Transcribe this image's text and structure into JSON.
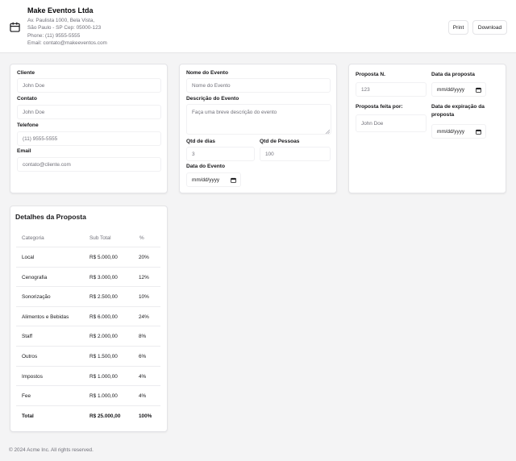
{
  "company": {
    "name": "Make Eventos Ltda",
    "address_line1": "Av. Paulista 1000, Bela Vista,",
    "address_line2": "São Paulo - SP Cep: 05000-123",
    "phone": "Phone: (11) 9555-5555",
    "email": "Email: contato@makeeventos.com"
  },
  "toolbar": {
    "print_label": "Print",
    "download_label": "Download"
  },
  "client": {
    "cliente_label": "Cliente",
    "cliente_placeholder": "John Doe",
    "contato_label": "Contato",
    "contato_placeholder": "John Doe",
    "telefone_label": "Telefone",
    "telefone_placeholder": "(11) 9555-5555",
    "email_label": "Email",
    "email_placeholder": "contato@cliente.com"
  },
  "event": {
    "nome_label": "Nome do Evento",
    "nome_placeholder": "Nome do Evento",
    "descricao_label": "Descrição do Evento",
    "descricao_placeholder": "Faça uma breve descrição do evento",
    "qtd_dias_label": "Qtd de dias",
    "qtd_dias_placeholder": "3",
    "qtd_pessoas_label": "Qtd de Pessoas",
    "qtd_pessoas_placeholder": "100",
    "data_label": "Data do Evento",
    "data_value": "mm/dd/yyyy"
  },
  "proposal": {
    "numero_label": "Proposta N.",
    "numero_placeholder": "123",
    "data_label": "Data da proposta",
    "data_value": "mm/dd/yyyy",
    "feita_por_label": "Proposta feita por:",
    "feita_por_placeholder": "John Doe",
    "expiracao_label": "Data de expiração da proposta",
    "expiracao_value": "mm/dd/yyyy"
  },
  "details": {
    "title": "Detalhes da Proposta",
    "columns": [
      "Categoria",
      "Sub Total",
      "%"
    ],
    "rows": [
      [
        "Local",
        "R$ 5.000,00",
        "20%"
      ],
      [
        "Cenografia",
        "R$ 3.000,00",
        "12%"
      ],
      [
        "Sonorização",
        "R$ 2.500,00",
        "10%"
      ],
      [
        "Alimentos e Bebidas",
        "R$ 6.000,00",
        "24%"
      ],
      [
        "Staff",
        "R$ 2.000,00",
        "8%"
      ],
      [
        "Outros",
        "R$ 1.500,00",
        "6%"
      ],
      [
        "Impostos",
        "R$ 1.000,00",
        "4%"
      ],
      [
        "Fee",
        "R$ 1.000,00",
        "4%"
      ],
      [
        "Total",
        "R$ 25.000,00",
        "100%"
      ]
    ]
  },
  "footer": {
    "text": "© 2024 Acme Inc. All rights reserved."
  }
}
